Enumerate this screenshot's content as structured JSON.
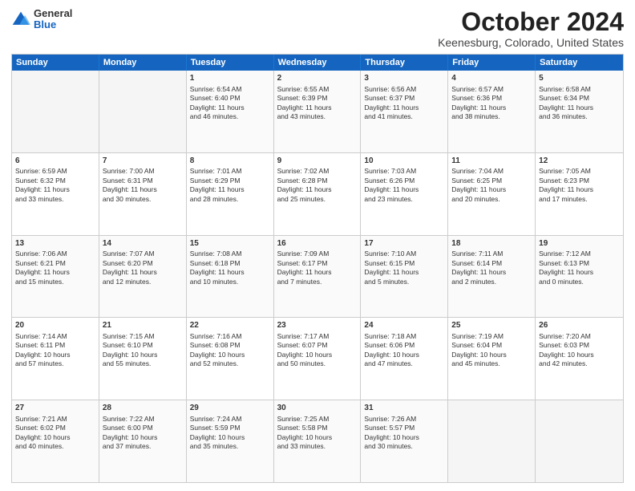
{
  "logo": {
    "general": "General",
    "blue": "Blue"
  },
  "title": "October 2024",
  "subtitle": "Keenesburg, Colorado, United States",
  "days": [
    "Sunday",
    "Monday",
    "Tuesday",
    "Wednesday",
    "Thursday",
    "Friday",
    "Saturday"
  ],
  "weeks": [
    [
      {
        "day": "",
        "content": ""
      },
      {
        "day": "",
        "content": ""
      },
      {
        "day": "1",
        "content": "Sunrise: 6:54 AM\nSunset: 6:40 PM\nDaylight: 11 hours\nand 46 minutes."
      },
      {
        "day": "2",
        "content": "Sunrise: 6:55 AM\nSunset: 6:39 PM\nDaylight: 11 hours\nand 43 minutes."
      },
      {
        "day": "3",
        "content": "Sunrise: 6:56 AM\nSunset: 6:37 PM\nDaylight: 11 hours\nand 41 minutes."
      },
      {
        "day": "4",
        "content": "Sunrise: 6:57 AM\nSunset: 6:36 PM\nDaylight: 11 hours\nand 38 minutes."
      },
      {
        "day": "5",
        "content": "Sunrise: 6:58 AM\nSunset: 6:34 PM\nDaylight: 11 hours\nand 36 minutes."
      }
    ],
    [
      {
        "day": "6",
        "content": "Sunrise: 6:59 AM\nSunset: 6:32 PM\nDaylight: 11 hours\nand 33 minutes."
      },
      {
        "day": "7",
        "content": "Sunrise: 7:00 AM\nSunset: 6:31 PM\nDaylight: 11 hours\nand 30 minutes."
      },
      {
        "day": "8",
        "content": "Sunrise: 7:01 AM\nSunset: 6:29 PM\nDaylight: 11 hours\nand 28 minutes."
      },
      {
        "day": "9",
        "content": "Sunrise: 7:02 AM\nSunset: 6:28 PM\nDaylight: 11 hours\nand 25 minutes."
      },
      {
        "day": "10",
        "content": "Sunrise: 7:03 AM\nSunset: 6:26 PM\nDaylight: 11 hours\nand 23 minutes."
      },
      {
        "day": "11",
        "content": "Sunrise: 7:04 AM\nSunset: 6:25 PM\nDaylight: 11 hours\nand 20 minutes."
      },
      {
        "day": "12",
        "content": "Sunrise: 7:05 AM\nSunset: 6:23 PM\nDaylight: 11 hours\nand 17 minutes."
      }
    ],
    [
      {
        "day": "13",
        "content": "Sunrise: 7:06 AM\nSunset: 6:21 PM\nDaylight: 11 hours\nand 15 minutes."
      },
      {
        "day": "14",
        "content": "Sunrise: 7:07 AM\nSunset: 6:20 PM\nDaylight: 11 hours\nand 12 minutes."
      },
      {
        "day": "15",
        "content": "Sunrise: 7:08 AM\nSunset: 6:18 PM\nDaylight: 11 hours\nand 10 minutes."
      },
      {
        "day": "16",
        "content": "Sunrise: 7:09 AM\nSunset: 6:17 PM\nDaylight: 11 hours\nand 7 minutes."
      },
      {
        "day": "17",
        "content": "Sunrise: 7:10 AM\nSunset: 6:15 PM\nDaylight: 11 hours\nand 5 minutes."
      },
      {
        "day": "18",
        "content": "Sunrise: 7:11 AM\nSunset: 6:14 PM\nDaylight: 11 hours\nand 2 minutes."
      },
      {
        "day": "19",
        "content": "Sunrise: 7:12 AM\nSunset: 6:13 PM\nDaylight: 11 hours\nand 0 minutes."
      }
    ],
    [
      {
        "day": "20",
        "content": "Sunrise: 7:14 AM\nSunset: 6:11 PM\nDaylight: 10 hours\nand 57 minutes."
      },
      {
        "day": "21",
        "content": "Sunrise: 7:15 AM\nSunset: 6:10 PM\nDaylight: 10 hours\nand 55 minutes."
      },
      {
        "day": "22",
        "content": "Sunrise: 7:16 AM\nSunset: 6:08 PM\nDaylight: 10 hours\nand 52 minutes."
      },
      {
        "day": "23",
        "content": "Sunrise: 7:17 AM\nSunset: 6:07 PM\nDaylight: 10 hours\nand 50 minutes."
      },
      {
        "day": "24",
        "content": "Sunrise: 7:18 AM\nSunset: 6:06 PM\nDaylight: 10 hours\nand 47 minutes."
      },
      {
        "day": "25",
        "content": "Sunrise: 7:19 AM\nSunset: 6:04 PM\nDaylight: 10 hours\nand 45 minutes."
      },
      {
        "day": "26",
        "content": "Sunrise: 7:20 AM\nSunset: 6:03 PM\nDaylight: 10 hours\nand 42 minutes."
      }
    ],
    [
      {
        "day": "27",
        "content": "Sunrise: 7:21 AM\nSunset: 6:02 PM\nDaylight: 10 hours\nand 40 minutes."
      },
      {
        "day": "28",
        "content": "Sunrise: 7:22 AM\nSunset: 6:00 PM\nDaylight: 10 hours\nand 37 minutes."
      },
      {
        "day": "29",
        "content": "Sunrise: 7:24 AM\nSunset: 5:59 PM\nDaylight: 10 hours\nand 35 minutes."
      },
      {
        "day": "30",
        "content": "Sunrise: 7:25 AM\nSunset: 5:58 PM\nDaylight: 10 hours\nand 33 minutes."
      },
      {
        "day": "31",
        "content": "Sunrise: 7:26 AM\nSunset: 5:57 PM\nDaylight: 10 hours\nand 30 minutes."
      },
      {
        "day": "",
        "content": ""
      },
      {
        "day": "",
        "content": ""
      }
    ]
  ]
}
